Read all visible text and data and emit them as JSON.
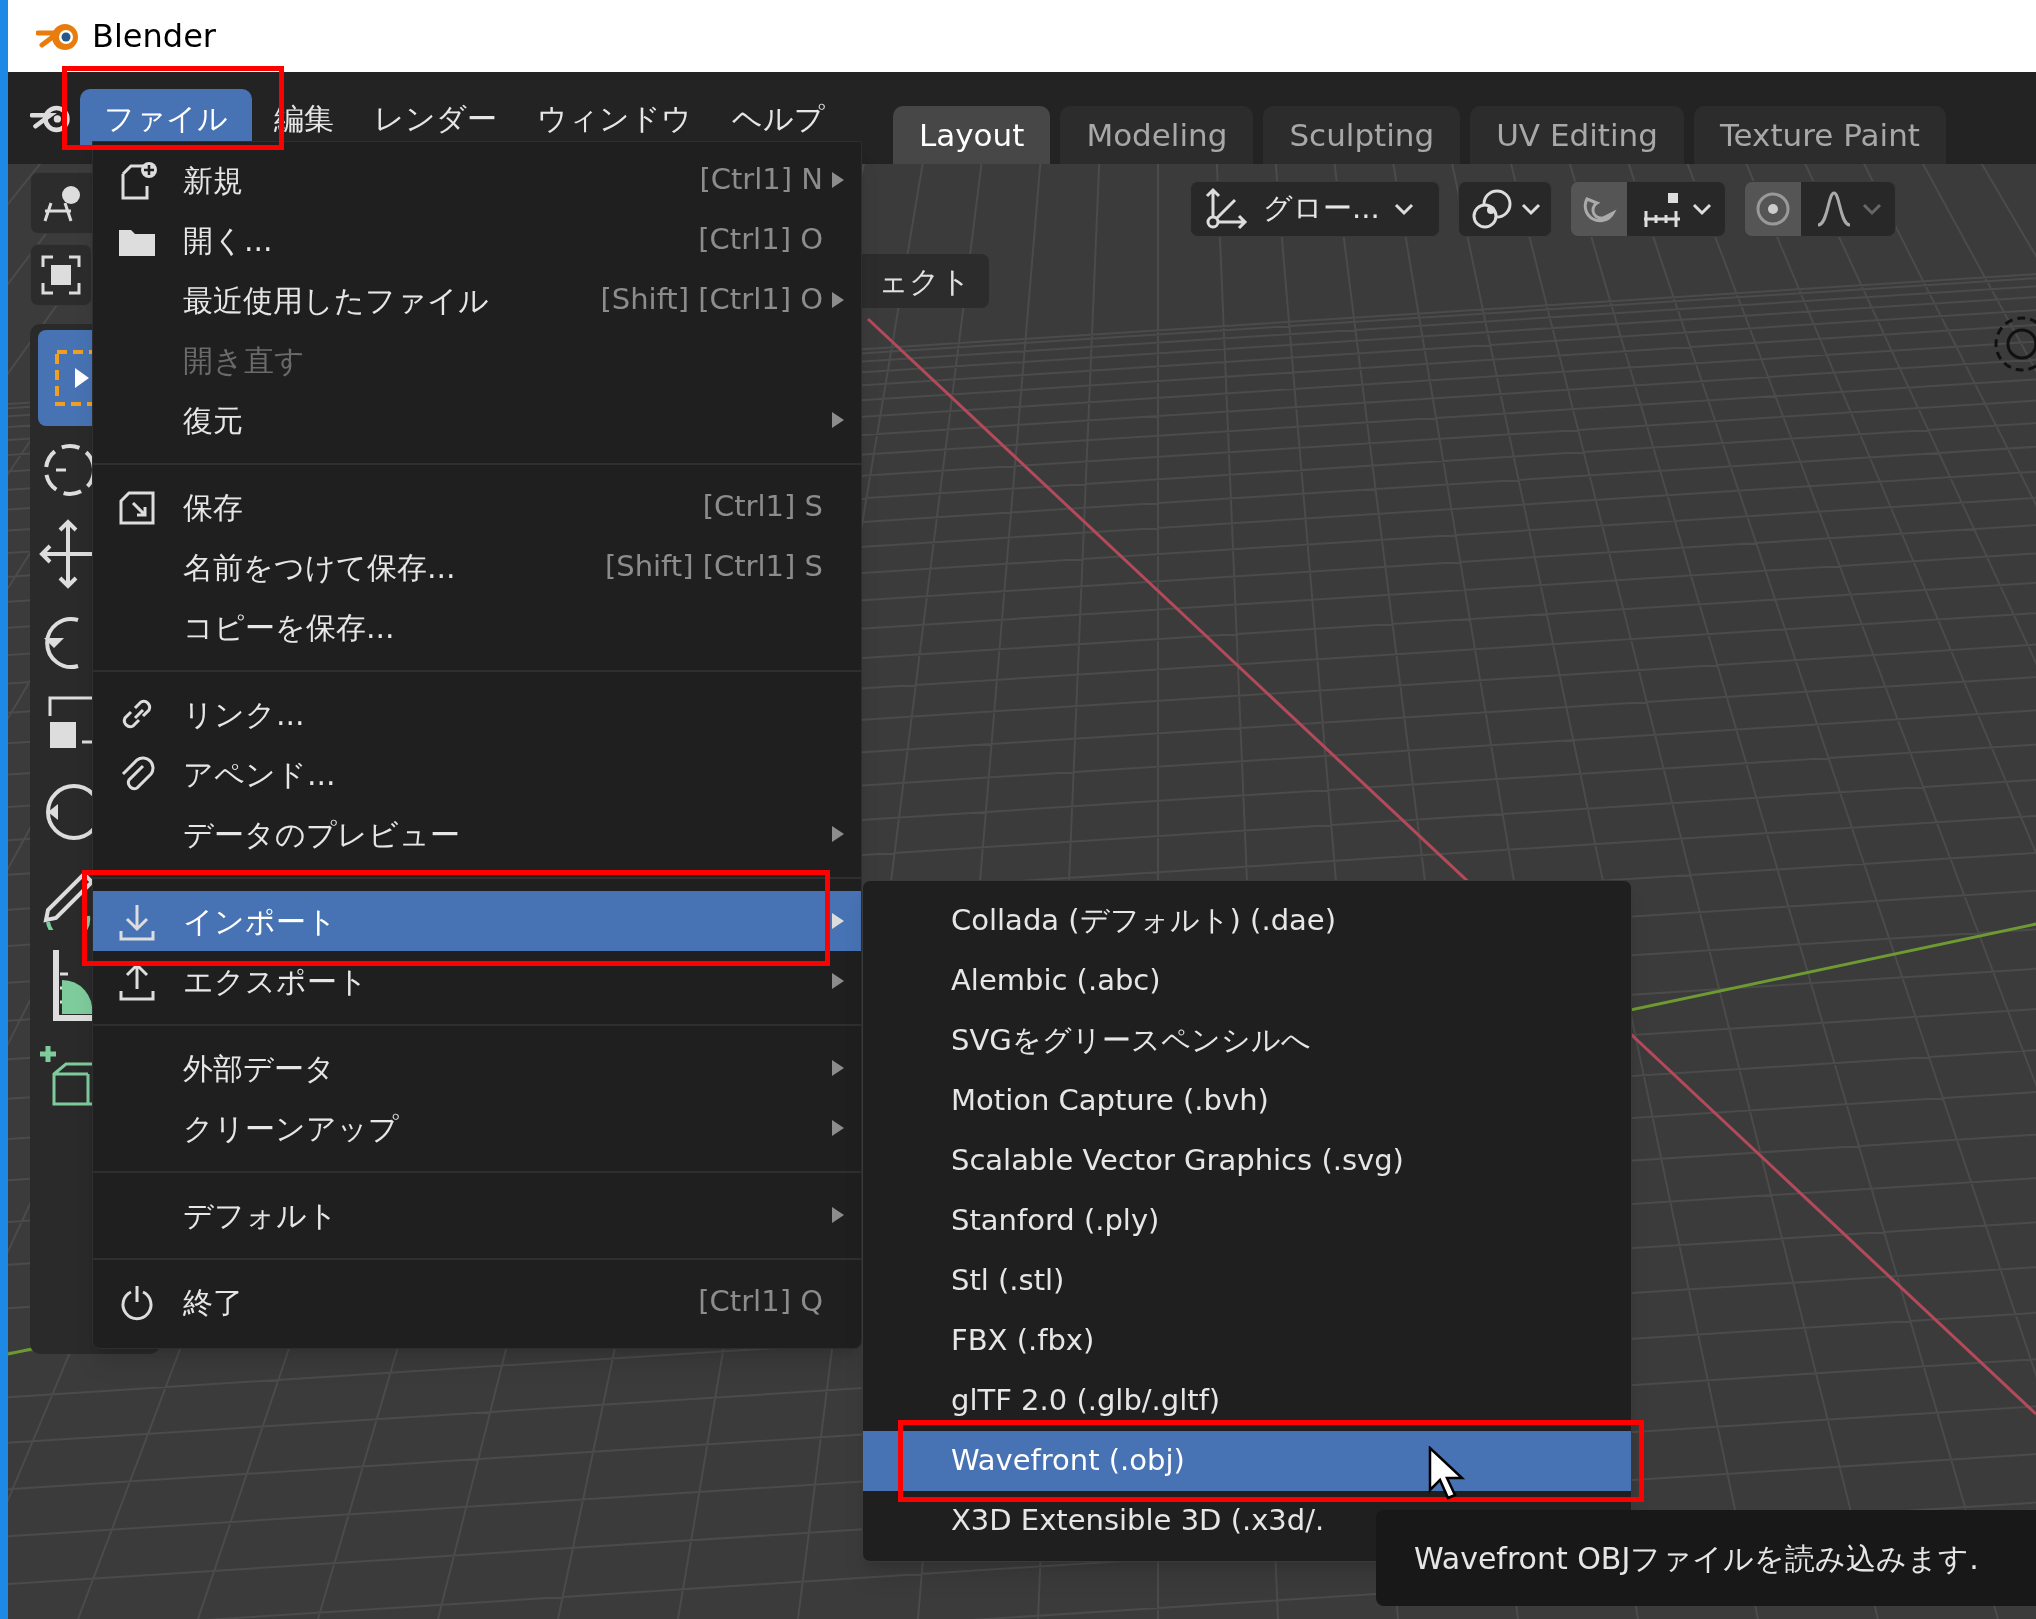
{
  "window": {
    "title": "Blender"
  },
  "menu_bar": [
    {
      "label": "ファイル",
      "selected": true
    },
    {
      "label": "編集",
      "selected": false
    },
    {
      "label": "レンダー",
      "selected": false
    },
    {
      "label": "ウィンドウ",
      "selected": false
    },
    {
      "label": "ヘルプ",
      "selected": false
    }
  ],
  "workspace_tabs": [
    {
      "label": "Layout",
      "selected": true
    },
    {
      "label": "Modeling",
      "selected": false
    },
    {
      "label": "Sculpting",
      "selected": false
    },
    {
      "label": "UV Editing",
      "selected": false
    },
    {
      "label": "Texture Paint",
      "selected": false
    }
  ],
  "header_tools": {
    "transform_orientation": "グロー...",
    "snap_on": false,
    "proportional_on": false
  },
  "viewport": {
    "header_fragment": "ェクト"
  },
  "file_menu": {
    "items": [
      {
        "kind": "item",
        "label": "新規",
        "shortcut": "[Ctrl1] N",
        "submenu": true,
        "disabled": false,
        "selected": false
      },
      {
        "kind": "item",
        "label": "開く...",
        "shortcut": "[Ctrl1] O",
        "submenu": false,
        "disabled": false,
        "selected": false
      },
      {
        "kind": "item",
        "label": "最近使用したファイル",
        "shortcut": "[Shift] [Ctrl1] O",
        "submenu": true,
        "disabled": false,
        "selected": false
      },
      {
        "kind": "item",
        "label": "開き直す",
        "submenu": false,
        "disabled": true,
        "selected": false
      },
      {
        "kind": "item",
        "label": "復元",
        "submenu": true,
        "disabled": false,
        "selected": false
      },
      {
        "kind": "separator"
      },
      {
        "kind": "item",
        "label": "保存",
        "shortcut": "[Ctrl1] S",
        "submenu": false,
        "disabled": false,
        "selected": false
      },
      {
        "kind": "item",
        "label": "名前をつけて保存...",
        "shortcut": "[Shift] [Ctrl1] S",
        "submenu": false,
        "disabled": false,
        "selected": false
      },
      {
        "kind": "item",
        "label": "コピーを保存...",
        "submenu": false,
        "disabled": false,
        "selected": false
      },
      {
        "kind": "separator"
      },
      {
        "kind": "item",
        "label": "リンク...",
        "submenu": false,
        "disabled": false,
        "selected": false
      },
      {
        "kind": "item",
        "label": "アペンド...",
        "submenu": false,
        "disabled": false,
        "selected": false
      },
      {
        "kind": "item",
        "label": "データのプレビュー",
        "submenu": true,
        "disabled": false,
        "selected": false
      },
      {
        "kind": "separator"
      },
      {
        "kind": "item",
        "label": "インポート",
        "submenu": true,
        "disabled": false,
        "selected": true
      },
      {
        "kind": "item",
        "label": "エクスポート",
        "submenu": true,
        "disabled": false,
        "selected": false
      },
      {
        "kind": "separator"
      },
      {
        "kind": "item",
        "label": "外部データ",
        "submenu": true,
        "disabled": false,
        "selected": false
      },
      {
        "kind": "item",
        "label": "クリーンアップ",
        "submenu": true,
        "disabled": false,
        "selected": false
      },
      {
        "kind": "separator"
      },
      {
        "kind": "item",
        "label": "デフォルト",
        "submenu": true,
        "disabled": false,
        "selected": false
      },
      {
        "kind": "separator"
      },
      {
        "kind": "item",
        "label": "終了",
        "shortcut": "[Ctrl1] Q",
        "submenu": false,
        "disabled": false,
        "selected": false
      }
    ]
  },
  "import_submenu": {
    "items": [
      {
        "label": "Collada (デフォルト) (.dae)",
        "selected": false
      },
      {
        "label": "Alembic (.abc)",
        "selected": false
      },
      {
        "label": "SVGをグリースペンシルへ",
        "selected": false
      },
      {
        "label": "Motion Capture (.bvh)",
        "selected": false
      },
      {
        "label": "Scalable Vector Graphics (.svg)",
        "selected": false
      },
      {
        "label": "Stanford (.ply)",
        "selected": false
      },
      {
        "label": "Stl (.stl)",
        "selected": false
      },
      {
        "label": "FBX (.fbx)",
        "selected": false
      },
      {
        "label": "glTF 2.0 (.glb/.gltf)",
        "selected": false
      },
      {
        "label": "Wavefront (.obj)",
        "selected": true
      },
      {
        "label": "X3D Extensible 3D (.x3d/.",
        "selected": false
      }
    ]
  },
  "tooltip": "Wavefront OBJファイルを読み込みます."
}
